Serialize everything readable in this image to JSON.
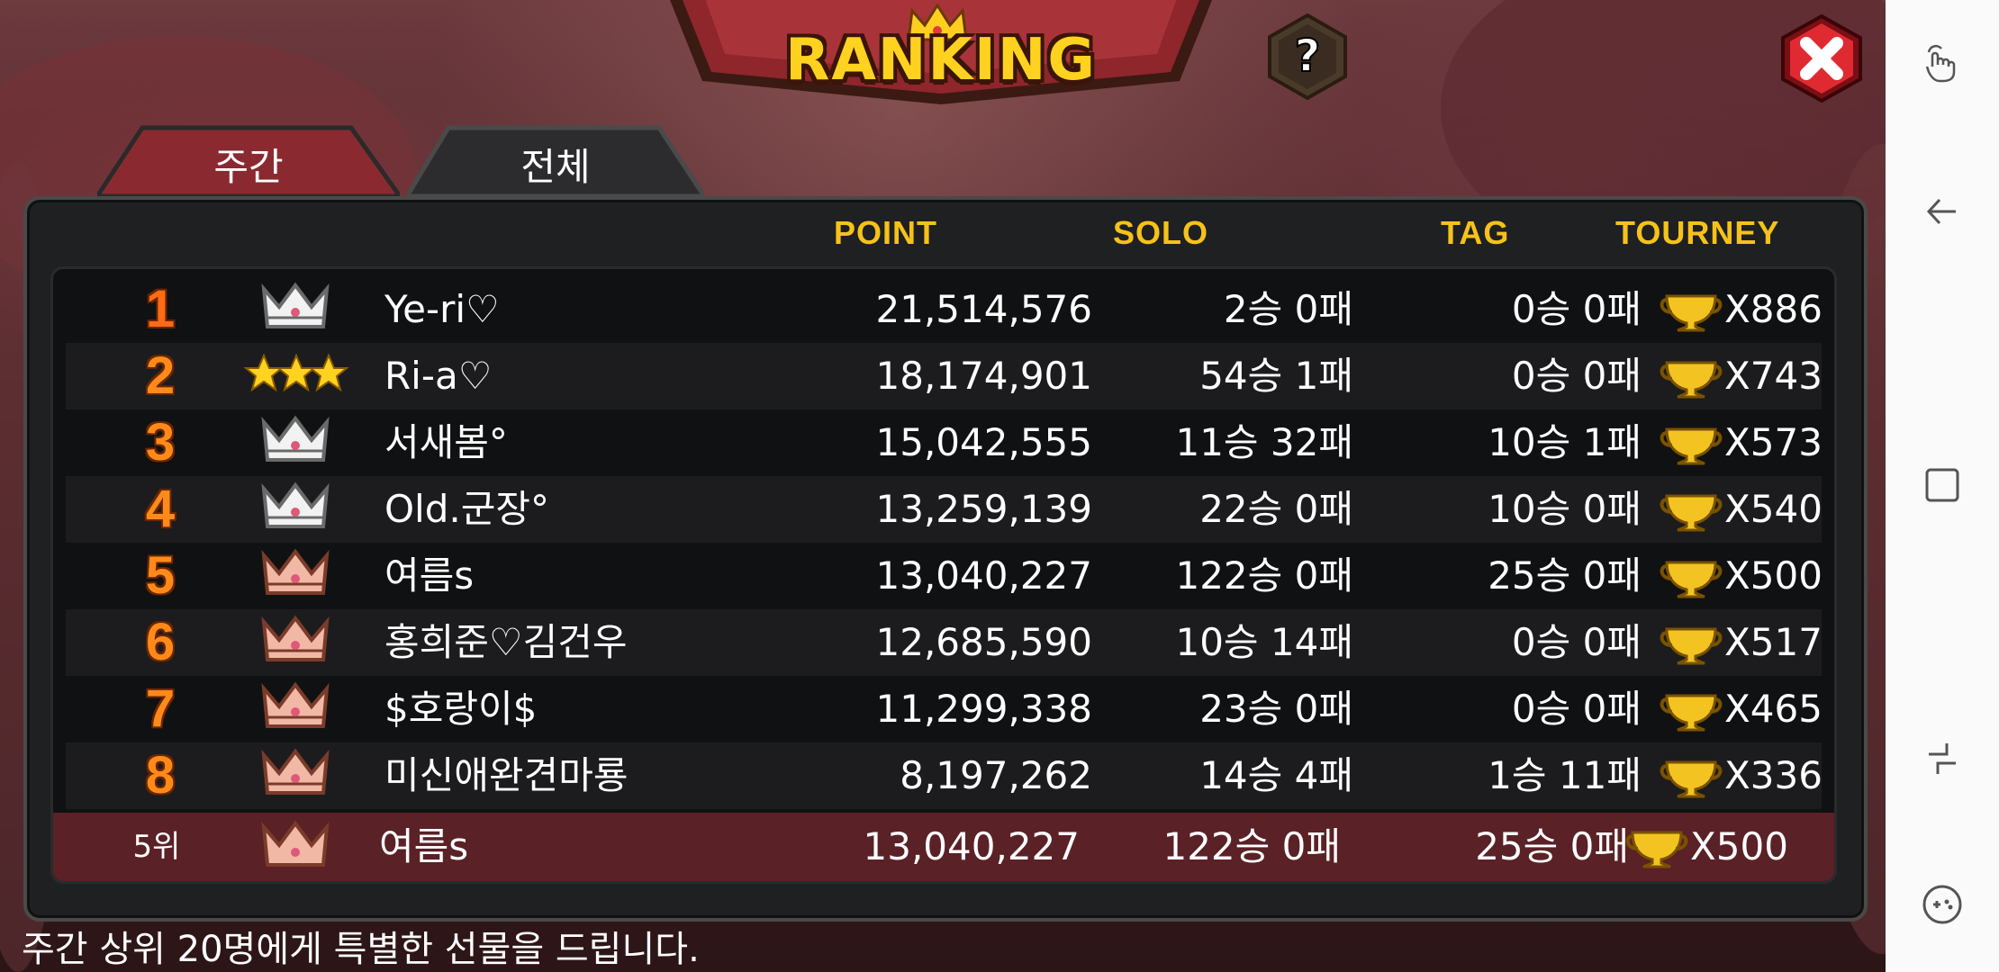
{
  "header": {
    "title": "RANKING",
    "help_label": "?"
  },
  "tabs": [
    {
      "label": "주간",
      "active": true
    },
    {
      "label": "전체",
      "active": false
    }
  ],
  "columns": {
    "point": "POINT",
    "solo": "SOLO",
    "tag": "TAG",
    "tourney": "TOURNEY"
  },
  "rows": [
    {
      "rank": "1",
      "badge": "silver-crown-icon",
      "name": "Ye-ri♡",
      "point": "21,514,576",
      "solo": "2승 0패",
      "tag": "0승 0패",
      "tourney": "X886"
    },
    {
      "rank": "2",
      "badge": "three-stars-icon",
      "name": "Ri-a♡",
      "point": "18,174,901",
      "solo": "54승 1패",
      "tag": "0승 0패",
      "tourney": "X743"
    },
    {
      "rank": "3",
      "badge": "silver-crown-icon",
      "name": "서새봄°",
      "point": "15,042,555",
      "solo": "11승 32패",
      "tag": "10승 1패",
      "tourney": "X573"
    },
    {
      "rank": "4",
      "badge": "silver-crown-icon",
      "name": "Old.군장°",
      "point": "13,259,139",
      "solo": "22승 0패",
      "tag": "10승 0패",
      "tourney": "X540"
    },
    {
      "rank": "5",
      "badge": "bronze-crown-icon",
      "name": "여름s",
      "point": "13,040,227",
      "solo": "122승 0패",
      "tag": "25승 0패",
      "tourney": "X500"
    },
    {
      "rank": "6",
      "badge": "bronze-crown-icon",
      "name": "홍희준♡김건우",
      "point": "12,685,590",
      "solo": "10승 14패",
      "tag": "0승 0패",
      "tourney": "X517"
    },
    {
      "rank": "7",
      "badge": "bronze-crown-icon",
      "name": "$호랑이$",
      "point": "11,299,338",
      "solo": "23승 0패",
      "tag": "0승 0패",
      "tourney": "X465"
    },
    {
      "rank": "8",
      "badge": "bronze-crown-icon",
      "name": "미신애완견마룡",
      "point": "8,197,262",
      "solo": "14승 4패",
      "tag": "1승 11패",
      "tourney": "X336"
    }
  ],
  "my_rank": {
    "rank": "5위",
    "badge": "bronze-crown-icon",
    "name": "여름s",
    "point": "13,040,227",
    "solo": "122승 0패",
    "tag": "25승 0패",
    "tourney": "X500"
  },
  "footer": "주간 상위 20명에게 특별한 선물을 드립니다.",
  "colors": {
    "accent": "#f6c21a",
    "rank": "#ff8a1a",
    "highlight_row": "#5a2126",
    "tab_active": "#8a2a30",
    "close": "#d8242e"
  }
}
